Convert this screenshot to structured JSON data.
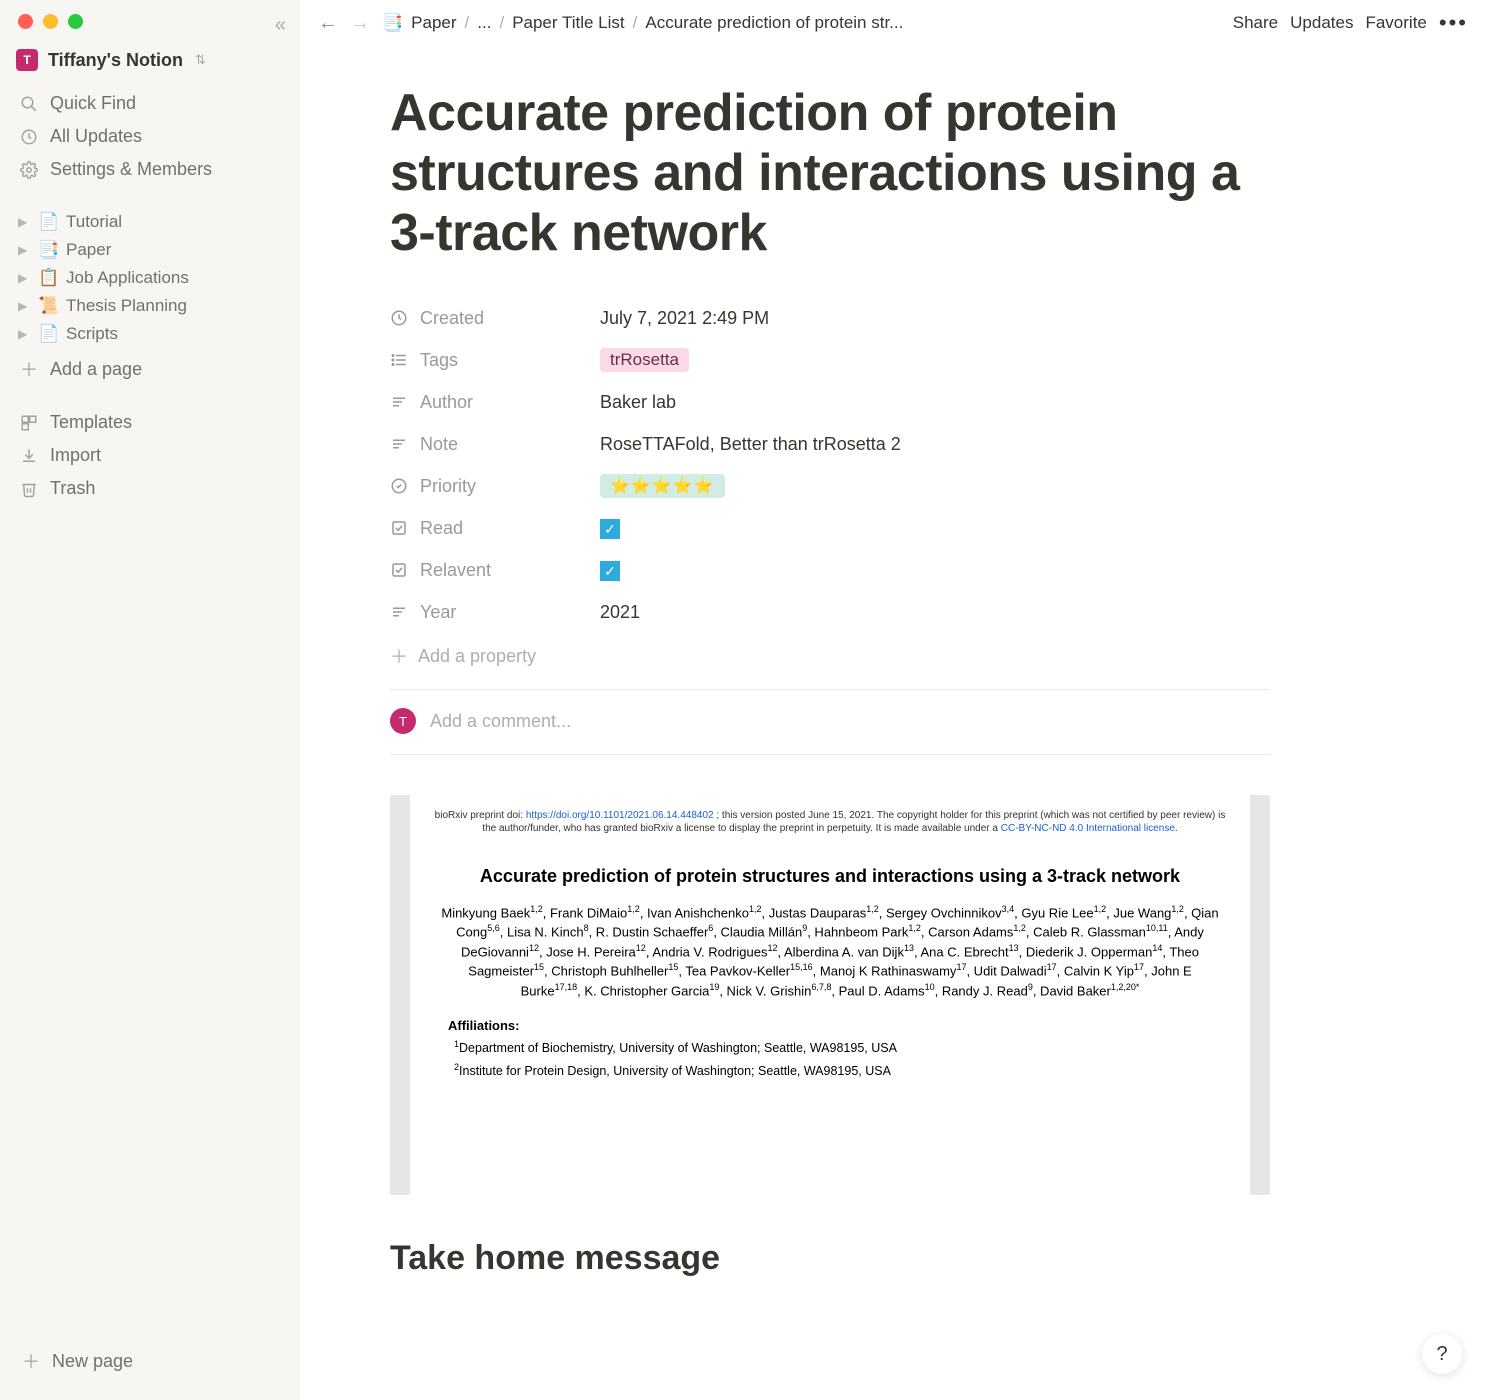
{
  "workspace": {
    "badge": "T",
    "name": "Tiffany's Notion"
  },
  "sidebar": {
    "quick_find": "Quick Find",
    "all_updates": "All Updates",
    "settings": "Settings & Members",
    "pages": [
      {
        "emoji": "📄",
        "label": "Tutorial"
      },
      {
        "emoji": "📑",
        "label": "Paper"
      },
      {
        "emoji": "📋",
        "label": "Job Applications"
      },
      {
        "emoji": "📜",
        "label": "Thesis Planning"
      },
      {
        "emoji": "📄",
        "label": "Scripts"
      }
    ],
    "add_page": "Add a page",
    "templates": "Templates",
    "import": "Import",
    "trash": "Trash",
    "new_page": "New page"
  },
  "topbar": {
    "breadcrumbs": [
      {
        "emoji": "📑",
        "label": "Paper"
      },
      {
        "label": "..."
      },
      {
        "label": "Paper Title List"
      },
      {
        "label": "Accurate prediction of protein str..."
      }
    ],
    "share": "Share",
    "updates": "Updates",
    "favorite": "Favorite"
  },
  "page": {
    "title": "Accurate prediction of protein structures and interactions using a 3-track network",
    "properties": {
      "created": {
        "label": "Created",
        "value": "July 7, 2021 2:49 PM"
      },
      "tags": {
        "label": "Tags",
        "value": "trRosetta"
      },
      "author": {
        "label": "Author",
        "value": "Baker lab"
      },
      "note": {
        "label": "Note",
        "value": "RoseTTAFold, Better than trRosetta 2"
      },
      "priority": {
        "label": "Priority",
        "value": "⭐⭐⭐⭐⭐"
      },
      "read": {
        "label": "Read",
        "checked": true
      },
      "relevant": {
        "label": "Relavent",
        "checked": true
      },
      "year": {
        "label": "Year",
        "value": "2021"
      }
    },
    "add_property": "Add a property",
    "comment_placeholder": "Add a comment...",
    "avatar_letter": "T",
    "section_heading": "Take home message"
  },
  "pdf": {
    "header_prefix": "bioRxiv preprint doi: ",
    "doi_link": "https://doi.org/10.1101/2021.06.14.448402",
    "header_rest": "; this version posted June 15, 2021. The copyright holder for this preprint (which was not certified by peer review) is the author/funder, who has granted bioRxiv a license to display the preprint in perpetuity. It is made available under a",
    "license": "CC-BY-NC-ND 4.0 International license",
    "title": "Accurate prediction of protein structures and interactions using a 3-track network",
    "affiliations_head": "Affiliations:",
    "aff1": "Department of Biochemistry, University of Washington; Seattle, WA98195, USA",
    "aff2": "Institute for Protein Design, University of Washington; Seattle, WA98195, USA"
  },
  "help": "?"
}
